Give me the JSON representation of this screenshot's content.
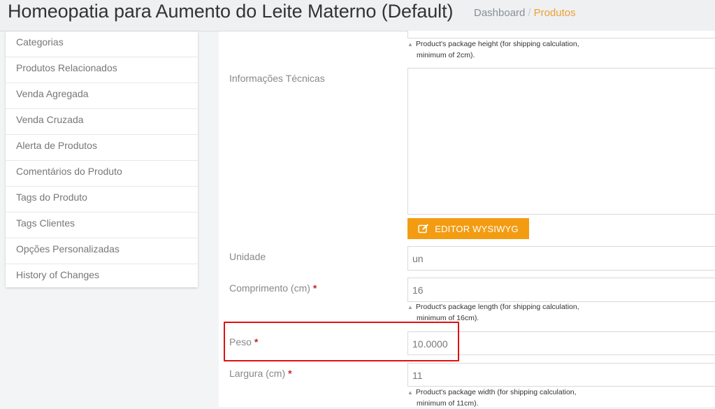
{
  "header": {
    "title": "Homeopatia para Aumento do Leite Materno (Default)",
    "breadcrumb": {
      "home": "Dashboard",
      "separator": "/",
      "current": "Produtos"
    }
  },
  "sidebar": {
    "items": [
      {
        "label": "Categorias"
      },
      {
        "label": "Produtos Relacionados"
      },
      {
        "label": "Venda Agregada"
      },
      {
        "label": "Venda Cruzada"
      },
      {
        "label": "Alerta de Produtos"
      },
      {
        "label": "Comentários do Produto"
      },
      {
        "label": "Tags do Produto"
      },
      {
        "label": "Tags Clientes"
      },
      {
        "label": "Opções Personalizadas"
      },
      {
        "label": "History of Changes"
      }
    ]
  },
  "form": {
    "height_hint": {
      "line1": "Product's package height (for shipping calculation,",
      "line2": "minimum of 2cm)."
    },
    "tech_info": {
      "label": "Informações Técnicas",
      "value": ""
    },
    "wysiwyg_button": "EDITOR WYSIWYG",
    "unidade": {
      "label": "Unidade",
      "value": "un"
    },
    "comprimento": {
      "label": "Comprimento (cm)",
      "required": "*",
      "value": "16",
      "hint_line1": "Product's package length (for shipping calculation,",
      "hint_line2": "minimum of 16cm)."
    },
    "peso": {
      "label": "Peso",
      "required": "*",
      "value": "10.0000"
    },
    "largura": {
      "label": "Largura (cm)",
      "required": "*",
      "value": "11",
      "hint_line1": "Product's package width (for shipping calculation,",
      "hint_line2": "minimum of 11cm)."
    }
  },
  "colors": {
    "accent": "#f39c12",
    "highlight": "#e01010",
    "required": "#c62828"
  }
}
